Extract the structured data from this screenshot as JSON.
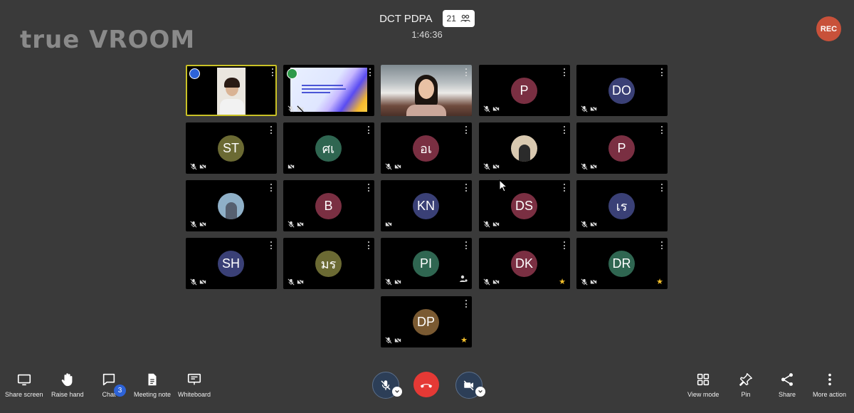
{
  "brand": {
    "logo_text": "true VROOM"
  },
  "meeting": {
    "title": "DCT PDPA",
    "participant_count": "21",
    "elapsed": "1:46:36",
    "rec_label": "REC"
  },
  "colors": {
    "background": "#3a3a3a",
    "active_speaker": "#c9c126",
    "rec": "#c8513a",
    "end_call": "#e53935",
    "chat_badge": "#2d63d8"
  },
  "tiles": [
    {
      "id": "t0",
      "initials": "",
      "kind": "video",
      "active": true
    },
    {
      "id": "t1",
      "initials": "",
      "kind": "screen-share"
    },
    {
      "id": "t2",
      "initials": "",
      "kind": "video"
    },
    {
      "id": "t3",
      "initials": "P",
      "avatar_color": "#7a2f42"
    },
    {
      "id": "t4",
      "initials": "DO",
      "avatar_color": "#3a4076"
    },
    {
      "id": "t5",
      "initials": "ST",
      "avatar_color": "#6b6a33"
    },
    {
      "id": "t6",
      "initials": "ศเ",
      "avatar_color": "#2f6651"
    },
    {
      "id": "t7",
      "initials": "อเ",
      "avatar_color": "#7a2f42"
    },
    {
      "id": "t8",
      "initials": "",
      "kind": "photo-avatar"
    },
    {
      "id": "t9",
      "initials": "P",
      "avatar_color": "#7a2f42"
    },
    {
      "id": "t10",
      "initials": "",
      "kind": "photo-avatar"
    },
    {
      "id": "t11",
      "initials": "B",
      "avatar_color": "#7a2f42"
    },
    {
      "id": "t12",
      "initials": "KN",
      "avatar_color": "#3a4076"
    },
    {
      "id": "t13",
      "initials": "DS",
      "avatar_color": "#7a2f42"
    },
    {
      "id": "t14",
      "initials": "เร",
      "avatar_color": "#3a4076"
    },
    {
      "id": "t15",
      "initials": "SH",
      "avatar_color": "#3a4076"
    },
    {
      "id": "t16",
      "initials": "มร",
      "avatar_color": "#6b6a33"
    },
    {
      "id": "t17",
      "initials": "PI",
      "avatar_color": "#2f6651"
    },
    {
      "id": "t18",
      "initials": "DK",
      "avatar_color": "#7a2f42"
    },
    {
      "id": "t19",
      "initials": "DR",
      "avatar_color": "#2f6651"
    },
    {
      "id": "t20",
      "initials": "DP",
      "avatar_color": "#7a5a32"
    }
  ],
  "toolbar": {
    "share_screen": "Share screen",
    "raise_hand": "Raise hand",
    "chat": "Chat",
    "chat_unread": "3",
    "meeting_note": "Meeting note",
    "whiteboard": "Whiteboard",
    "view_mode": "View mode",
    "pin": "Pin",
    "share": "Share",
    "more_action": "More action"
  }
}
